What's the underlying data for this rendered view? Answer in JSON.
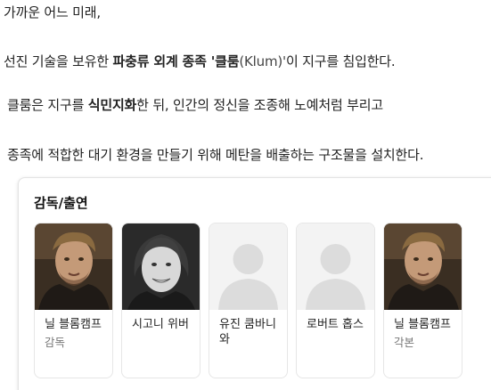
{
  "paragraphs": {
    "p1": "가까운 어느 미래,",
    "p2_pre": "선진 기술을 보유한 ",
    "p2_bold": "파충류 외계 종족 '클룸",
    "p2_light": "(Klum)'",
    "p2_post": "이 지구를 침입한다.",
    "p3_pre": "클룸은 지구를 ",
    "p3_bold": "식민지화",
    "p3_post": "한 뒤, 인간의 정신을 조종해 노예처럼 부리고",
    "p4": "종족에 적합한 대기 환경을 만들기 위해 메탄을 배출하는 구조물을 설치한다."
  },
  "cast": {
    "title": "감독/출연",
    "people": [
      {
        "name": "닐 블롬캠프",
        "role": "감독",
        "photo": "man-photo"
      },
      {
        "name": "시고니 위버",
        "role": "",
        "photo": "woman-photo"
      },
      {
        "name": "유진 쿰바니와",
        "role": "",
        "photo": "placeholder-avatar-icon"
      },
      {
        "name": "로버트 홉스",
        "role": "",
        "photo": "placeholder-avatar-icon"
      },
      {
        "name": "닐 블롬캠프",
        "role": "각본",
        "photo": "man-photo"
      }
    ]
  }
}
